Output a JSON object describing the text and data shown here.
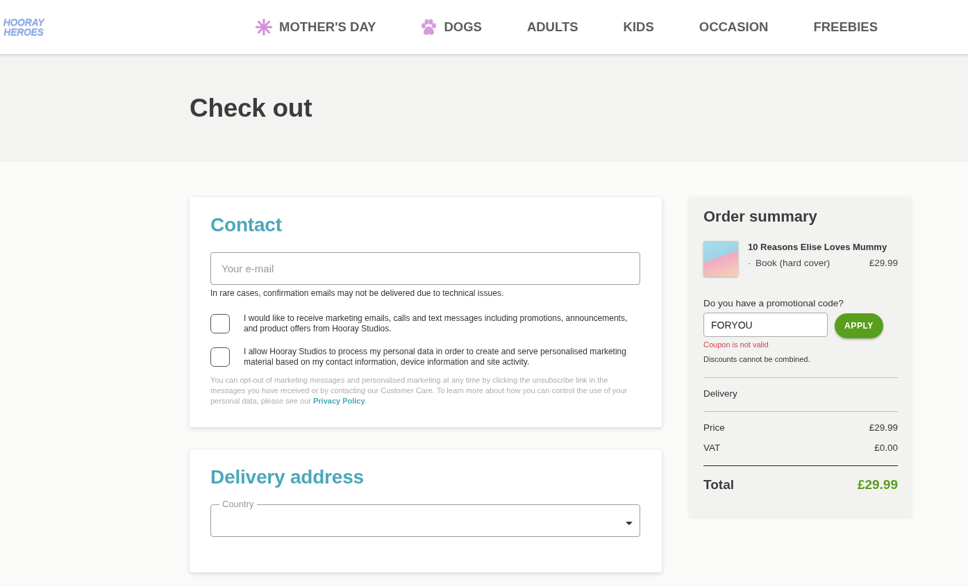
{
  "header": {
    "logo": "HOORAY HEROES",
    "nav": [
      {
        "label": "MOTHER'S DAY",
        "kind": "seasonal"
      },
      {
        "label": "DOGS",
        "kind": "pets"
      },
      {
        "label": "ADULTS",
        "kind": "plain"
      },
      {
        "label": "KIDS",
        "kind": "plain"
      },
      {
        "label": "OCCASION",
        "kind": "plain"
      },
      {
        "label": "FREEBIES",
        "kind": "plain"
      }
    ]
  },
  "page_title": "Check out",
  "contact": {
    "title": "Contact",
    "email": {
      "placeholder": "Your e-mail"
    },
    "email_note": "In rare cases, confirmation emails may not be delivered due to technical issues.",
    "consents": [
      {
        "text": "I would like to receive marketing emails, calls and text messages including promotions, announcements, and product offers from Hooray Studios.",
        "checked": false
      },
      {
        "text": "I allow Hooray Studios to process my personal data in order to create and serve personalised marketing material based on my contact information, device information and site activity.",
        "checked": false
      }
    ],
    "notice": {
      "text": "You can opt-out of marketing messages and personalised marketing at any time by clicking the unsubscribe link in the messages you have received or by contacting our Customer Care. To learn more about how you can control the use of your personal data, please see our ",
      "link": "Privacy Policy",
      "end": "."
    }
  },
  "delivery": {
    "title": "Delivery address",
    "country": {
      "label": "Country"
    }
  },
  "order_summary": {
    "title": "Order summary",
    "items": [
      {
        "name": "10 Reasons Elise Loves Mummy",
        "bullet": "·",
        "variant": "Book (hard cover)",
        "price": "£29.99"
      }
    ],
    "promo": {
      "label": "Do you have a promotional code?",
      "value": "FORYOU",
      "button": "APPLY",
      "error": "Coupon is not valid",
      "note": "Discounts cannot be combined."
    },
    "delivery_label": "Delivery",
    "lines": [
      {
        "label": "Price",
        "value": "£29.99"
      },
      {
        "label": "VAT",
        "value": "£0.00"
      }
    ],
    "total": {
      "label": "Total",
      "value": "£29.99"
    }
  }
}
